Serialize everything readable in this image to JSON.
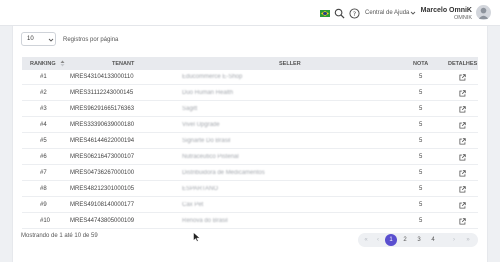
{
  "header": {
    "help_label": "Central de Ajuda",
    "user_name": "Marcelo OmniK",
    "user_org": "OMNIK"
  },
  "page_size": {
    "value": "10",
    "label": "Registros por página"
  },
  "table": {
    "columns": {
      "ranking": "RANKING",
      "tenant": "TENANT",
      "seller": "SELLER",
      "nota": "NOTA",
      "detalhes": "DETALHES"
    },
    "rows": [
      {
        "rank": "#1",
        "tenant": "MRES43104133000110",
        "seller": "Educommerce E-Shop",
        "nota": "5"
      },
      {
        "rank": "#2",
        "tenant": "MRES31112243000145",
        "seller": "Duo Human Health",
        "nota": "5"
      },
      {
        "rank": "#3",
        "tenant": "MRES96291665176363",
        "seller": "Sagitt",
        "nota": "5"
      },
      {
        "rank": "#4",
        "tenant": "MRES33390639000180",
        "seller": "Vivel Upgrade",
        "nota": "5"
      },
      {
        "rank": "#5",
        "tenant": "MRES46144622000194",
        "seller": "Signarte Do Brasil",
        "nota": "5"
      },
      {
        "rank": "#6",
        "tenant": "MRES06216473000107",
        "seller": "Nutraceutico Pistenal",
        "nota": "5"
      },
      {
        "rank": "#7",
        "tenant": "MRES04736267000100",
        "seller": "Distribuidora de Medicamentos",
        "nota": "5"
      },
      {
        "rank": "#8",
        "tenant": "MRES48212301000105",
        "seller": "ESPARTANO",
        "nota": "5"
      },
      {
        "rank": "#9",
        "tenant": "MRES49108140000177",
        "seller": "Cax Pet",
        "nota": "5"
      },
      {
        "rank": "#10",
        "tenant": "MRES44743805000109",
        "seller": "Renova do Brasil",
        "nota": "5"
      }
    ]
  },
  "footer": {
    "showing": "Mostrando de 1 até 10 de 59"
  },
  "pagination": {
    "first": "«",
    "prev": "‹",
    "pages": [
      "1",
      "2",
      "3",
      "4"
    ],
    "next": "›",
    "last": "»",
    "current": "1"
  },
  "colors": {
    "accent": "#5a4fcf",
    "header_bg": "#e8eaee",
    "page_bg": "#eef0f3"
  },
  "icons": [
    "brazil-flag-icon",
    "search-icon",
    "help-icon",
    "chevron-down-icon",
    "avatar-icon",
    "sort-icon",
    "external-link-icon",
    "mouse-cursor-icon"
  ]
}
